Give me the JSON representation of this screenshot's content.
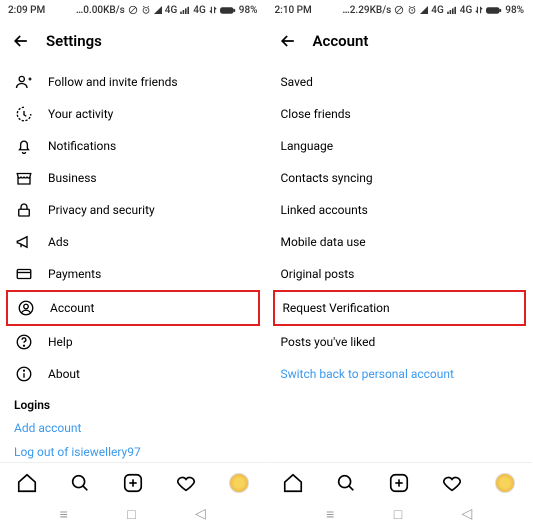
{
  "left": {
    "status": {
      "time": "2:09 PM",
      "net": "0.00KB/s",
      "sig1": "4G",
      "sig2": "4G",
      "battery": "98%"
    },
    "header": {
      "title": "Settings"
    },
    "items": [
      {
        "label": "Follow and invite friends"
      },
      {
        "label": "Your activity"
      },
      {
        "label": "Notifications"
      },
      {
        "label": "Business"
      },
      {
        "label": "Privacy and security"
      },
      {
        "label": "Ads"
      },
      {
        "label": "Payments"
      },
      {
        "label": "Account"
      },
      {
        "label": "Help"
      },
      {
        "label": "About"
      }
    ],
    "section": "Logins",
    "links": {
      "add": "Add account",
      "logout": "Log out of isiewellery97"
    }
  },
  "right": {
    "status": {
      "time": "2:10 PM",
      "net": "2.29KB/s",
      "sig1": "4G",
      "sig2": "4G",
      "battery": "98%"
    },
    "header": {
      "title": "Account"
    },
    "items": [
      {
        "label": "Saved"
      },
      {
        "label": "Close friends"
      },
      {
        "label": "Language"
      },
      {
        "label": "Contacts syncing"
      },
      {
        "label": "Linked accounts"
      },
      {
        "label": "Mobile data use"
      },
      {
        "label": "Original posts"
      },
      {
        "label": "Request Verification"
      },
      {
        "label": "Posts you've liked"
      }
    ],
    "switch": "Switch back to personal account"
  }
}
